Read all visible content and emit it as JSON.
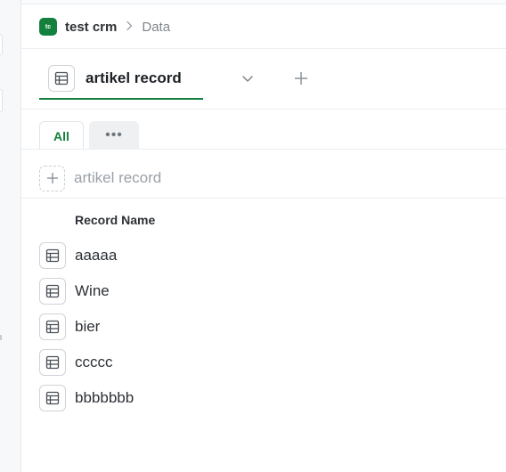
{
  "breadcrumb": {
    "workspace_badge": "tc",
    "workspace_name": "test crm",
    "separator": ">",
    "current_page": "Data"
  },
  "table_tab": {
    "label": "artikel record",
    "icon": "table-icon"
  },
  "view_tabs": {
    "all_label": "All",
    "more_label": "•••"
  },
  "add_row": {
    "label": "artikel record"
  },
  "table": {
    "column_header": "Record Name",
    "rows": [
      "aaaaa",
      "Wine",
      "bier",
      "ccccc",
      "bbbbbbb"
    ]
  },
  "colors": {
    "accent": "#13803d",
    "text": "#1f2328",
    "muted": "#9aa1a8"
  }
}
